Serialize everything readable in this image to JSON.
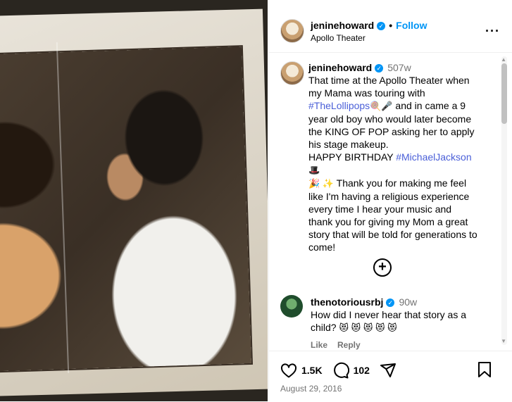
{
  "post": {
    "username": "jeninehoward",
    "follow_label": "Follow",
    "location": "Apollo Theater"
  },
  "caption": {
    "username": "jeninehoward",
    "time": "507w",
    "text_1": "That time at the Apollo Theater when my Mama was touring with ",
    "hashtag_1": "#TheLollipops",
    "emoji_1": "🍭🎤",
    "text_2": " and in came a 9 year old boy who would later become the KING OF POP asking her to apply his stage makeup.",
    "text_3": "HAPPY BIRTHDAY ",
    "hashtag_2": "#MichaelJackson",
    "emoji_2": "🎩",
    "emoji_3": "🎉 ✨",
    "text_4": " Thank you for making me feel like I'm having a religious experience every time I hear your music and thank you for giving my Mom a great story that will be told for generations to come!"
  },
  "comment": {
    "username": "thenotoriousrbj",
    "time": "90w",
    "text": "How did I never hear that story as a child?",
    "emojis": "😻 😻 😻 😻 😻",
    "like_label": "Like",
    "reply_label": "Reply"
  },
  "footer": {
    "likes": "1.5K",
    "comments": "102",
    "date": "August 29, 2016"
  },
  "icons": [
    "verified-icon",
    "more-icon",
    "add-comments-icon",
    "heart-icon",
    "comment-icon",
    "share-icon",
    "bookmark-icon"
  ],
  "colors": {
    "accent": "#0095f6",
    "hashtag": "#4a5fd8",
    "muted": "#737373"
  }
}
